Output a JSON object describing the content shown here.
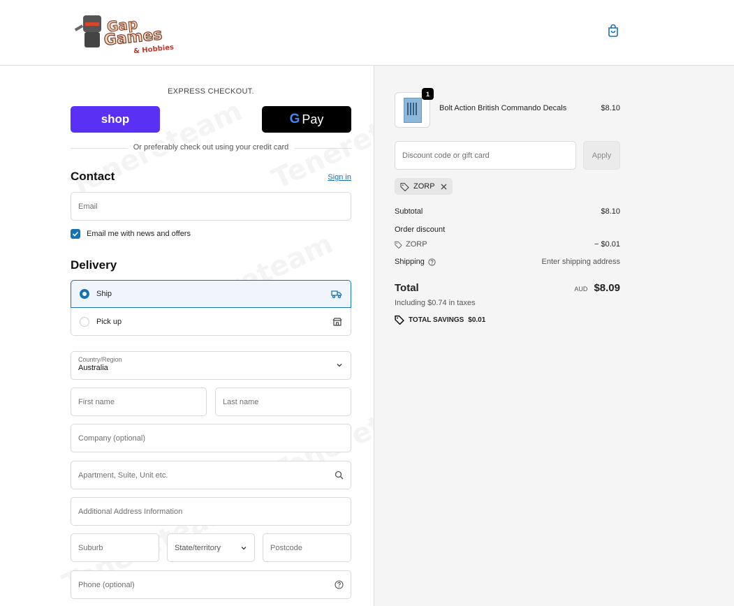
{
  "store": {
    "logo_text": "Gap Games & Hobbies"
  },
  "express": {
    "label": "EXPRESS CHECKOUT.",
    "shop_label": "shop",
    "gpay_label": "Pay",
    "divider_text": "Or preferably check out using your credit card"
  },
  "contact": {
    "title": "Contact",
    "signin": "Sign in",
    "email_placeholder": "Email",
    "marketing_label": "Email me with news and offers"
  },
  "delivery": {
    "title": "Delivery",
    "ship_label": "Ship",
    "pickup_label": "Pick up",
    "country_label": "Country/Region",
    "country_value": "Australia",
    "first_name_placeholder": "First name",
    "last_name_placeholder": "Last name",
    "company_placeholder": "Company (optional)",
    "address_placeholder": "Apartment, Suite, Unit etc.",
    "additional_placeholder": "Additional Address Information",
    "suburb_placeholder": "Suburb",
    "state_placeholder": "State/territory",
    "postcode_placeholder": "Postcode",
    "phone_placeholder": "Phone (optional)"
  },
  "summary": {
    "item_qty": "1",
    "item_name": "Bolt Action British Commando Decals",
    "item_price": "$8.10",
    "discount_placeholder": "Discount code or gift card",
    "apply_label": "Apply",
    "code_chip": "ZORP",
    "subtotal_label": "Subtotal",
    "subtotal_value": "$8.10",
    "order_discount_label": "Order discount",
    "discount_code": "ZORP",
    "discount_value": "− $0.01",
    "shipping_label": "Shipping",
    "shipping_value": "Enter shipping address",
    "total_label": "Total",
    "currency": "AUD",
    "total_value": "$8.09",
    "taxes_note": "Including $0.74 in taxes",
    "savings_label": "TOTAL SAVINGS",
    "savings_value": "$0.01"
  },
  "colors": {
    "accent": "#1773b0",
    "shop_purple": "#5a31f4",
    "panel_bg": "#f5f5f5"
  },
  "watermark": "Tenereteam"
}
